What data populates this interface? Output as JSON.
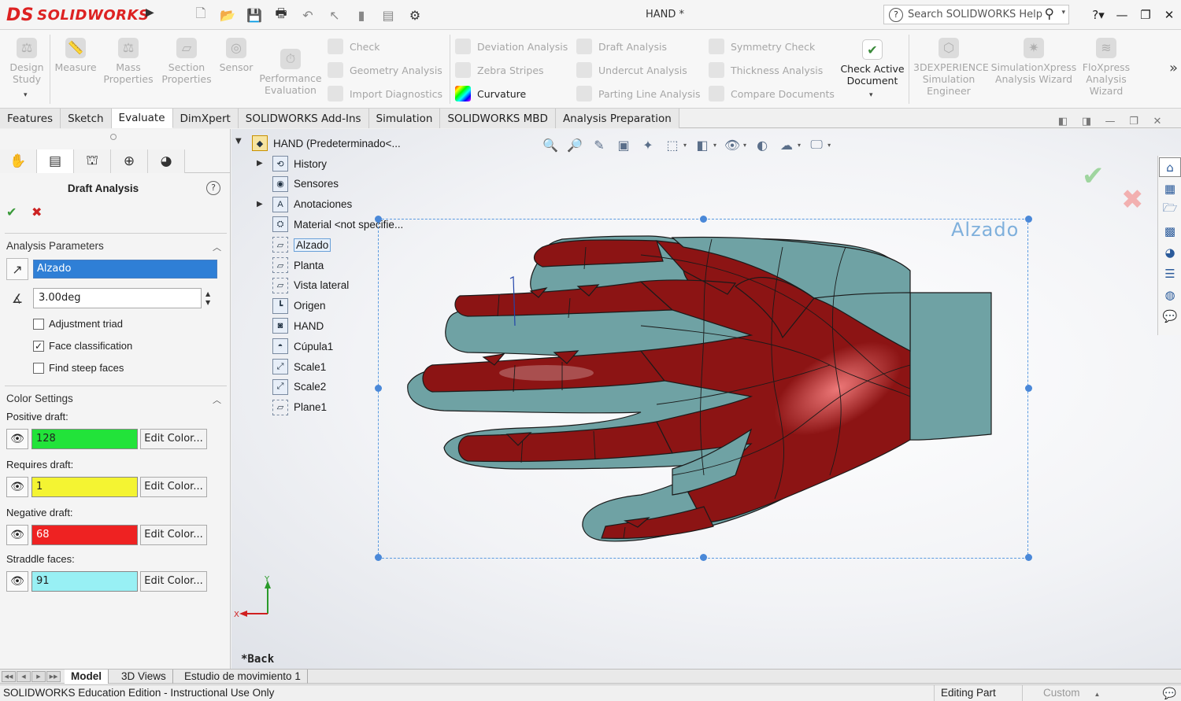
{
  "app": {
    "logo": "SOLIDWORKS",
    "logo_mark": "DS",
    "document_title": "HAND *",
    "search_placeholder": "Search SOLIDWORKS Help",
    "help_glyph": "?"
  },
  "ribbon": {
    "design_study": "Design\nStudy",
    "measure": "Measure",
    "mass_properties": "Mass\nProperties",
    "section_properties": "Section\nProperties",
    "sensor": "Sensor",
    "performance_evaluation": "Performance\nEvaluation",
    "check": "Check",
    "geometry_analysis": "Geometry Analysis",
    "import_diagnostics": "Import Diagnostics",
    "deviation_analysis": "Deviation Analysis",
    "zebra_stripes": "Zebra Stripes",
    "curvature": "Curvature",
    "draft_analysis": "Draft Analysis",
    "undercut_analysis": "Undercut Analysis",
    "parting_line_analysis": "Parting Line Analysis",
    "symmetry_check": "Symmetry Check",
    "thickness_analysis": "Thickness Analysis",
    "compare_documents": "Compare Documents",
    "check_active_document": "Check Active\nDocument",
    "experience_sim": "3DEXPERIENCE\nSimulation\nEngineer",
    "simxpress": "SimulationXpress\nAnalysis Wizard",
    "floxpress": "FloXpress\nAnalysis\nWizard"
  },
  "command_tabs": [
    "Features",
    "Sketch",
    "Evaluate",
    "DimXpert",
    "SOLIDWORKS Add-Ins",
    "Simulation",
    "SOLIDWORKS MBD",
    "Analysis Preparation"
  ],
  "active_command_tab": "Evaluate",
  "property_manager": {
    "title": "Draft Analysis",
    "analysis_parameters": {
      "header": "Analysis Parameters",
      "direction_value": "Alzado",
      "angle_value": "3.00deg",
      "checkboxes": [
        {
          "label": "Adjustment triad",
          "checked": false
        },
        {
          "label": "Face classification",
          "checked": true
        },
        {
          "label": "Find steep faces",
          "checked": false
        }
      ]
    },
    "color_settings": {
      "header": "Color Settings",
      "edit_label": "Edit Color...",
      "items": [
        {
          "label": "Positive draft:",
          "count": "128",
          "color": "#22e33a"
        },
        {
          "label": "Requires draft:",
          "count": "1",
          "color": "#f4f432"
        },
        {
          "label": "Negative draft:",
          "count": "68",
          "color": "#ee2222"
        },
        {
          "label": "Straddle faces:",
          "count": "91",
          "color": "#98f0f4"
        }
      ]
    }
  },
  "tree": {
    "root": "HAND  (Predeterminado<...",
    "items": [
      {
        "label": "History",
        "icon": "history-icon",
        "expand": true
      },
      {
        "label": "Sensores",
        "icon": "sensor-icon",
        "expand": false
      },
      {
        "label": "Anotaciones",
        "icon": "annotation-icon",
        "expand": true
      },
      {
        "label": "Material <not specifie...",
        "icon": "material-icon",
        "expand": false
      },
      {
        "label": "Alzado",
        "icon": "plane-icon",
        "expand": false,
        "selected": true
      },
      {
        "label": "Planta",
        "icon": "plane-icon",
        "expand": false
      },
      {
        "label": "Vista lateral",
        "icon": "plane-icon",
        "expand": false
      },
      {
        "label": "Origen",
        "icon": "origin-icon",
        "expand": false
      },
      {
        "label": "HAND",
        "icon": "body-icon",
        "expand": false
      },
      {
        "label": "Cúpula1",
        "icon": "dome-icon",
        "expand": false
      },
      {
        "label": "Scale1",
        "icon": "scale-icon",
        "expand": false
      },
      {
        "label": "Scale2",
        "icon": "scale-icon",
        "expand": false
      },
      {
        "label": "Plane1",
        "icon": "plane-icon",
        "expand": false
      }
    ]
  },
  "viewport": {
    "view_label": "Alzado",
    "orientation_label": "*Back",
    "axis_x": "X",
    "axis_y": "Y",
    "model_colors": {
      "negative": "#8c1414",
      "straddle": "#6fa2a4",
      "edge": "#1a1a1a"
    }
  },
  "bottom_tabs": [
    "Model",
    "3D Views",
    "Estudio de movimiento 1"
  ],
  "active_bottom_tab": "Model",
  "status": {
    "left": "SOLIDWORKS Education Edition - Instructional Use Only",
    "editing": "Editing Part",
    "custom": "Custom"
  }
}
